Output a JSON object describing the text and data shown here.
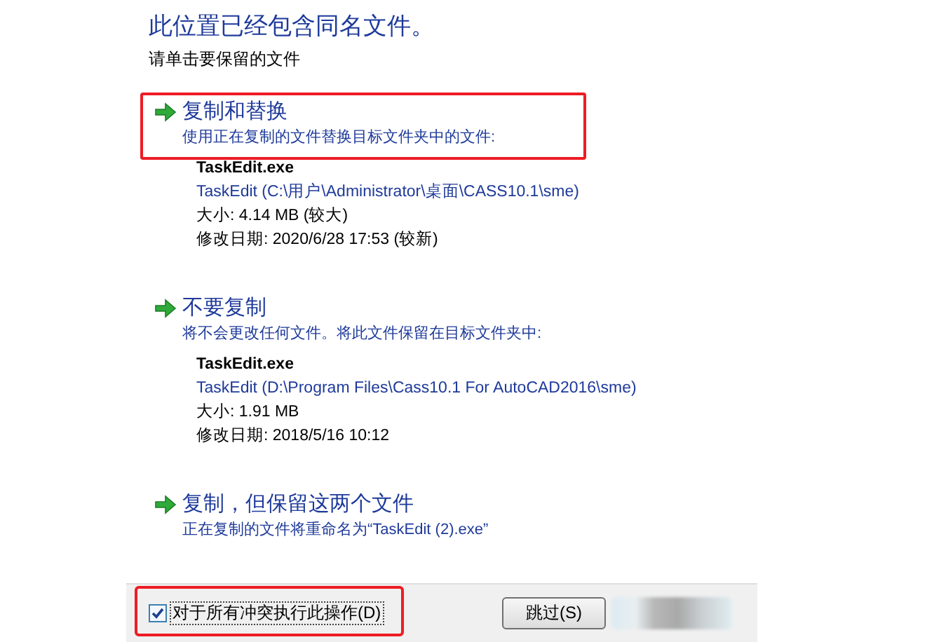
{
  "heading": "此位置已经包含同名文件。",
  "instruction": "请单击要保留的文件",
  "options": [
    {
      "title": "复制和替换",
      "description": "使用正在复制的文件替换目标文件夹中的文件:",
      "highlighted": true,
      "file": {
        "name": "TaskEdit.exe",
        "path": "TaskEdit (C:\\用户\\Administrator\\桌面\\CASS10.1\\sme)",
        "size": "大小: 4.14 MB (较大)",
        "date": "修改日期: 2020/6/28 17:53 (较新)"
      }
    },
    {
      "title": "不要复制",
      "description": "将不会更改任何文件。将此文件保留在目标文件夹中:",
      "highlighted": false,
      "file": {
        "name": "TaskEdit.exe",
        "path": "TaskEdit (D:\\Program Files\\Cass10.1 For AutoCAD2016\\sme)",
        "size": "大小: 1.91 MB",
        "date": "修改日期: 2018/5/16 10:12"
      }
    },
    {
      "title": "复制，但保留这两个文件",
      "description": "正在复制的文件将重命名为“TaskEdit (2).exe”",
      "highlighted": false
    }
  ],
  "apply_all": {
    "label": "对于所有冲突执行此操作(D)",
    "checked": true,
    "highlighted": true
  },
  "buttons": [
    {
      "label": "跳过(S)",
      "kind": "button"
    },
    {
      "kind": "obscured"
    }
  ]
}
